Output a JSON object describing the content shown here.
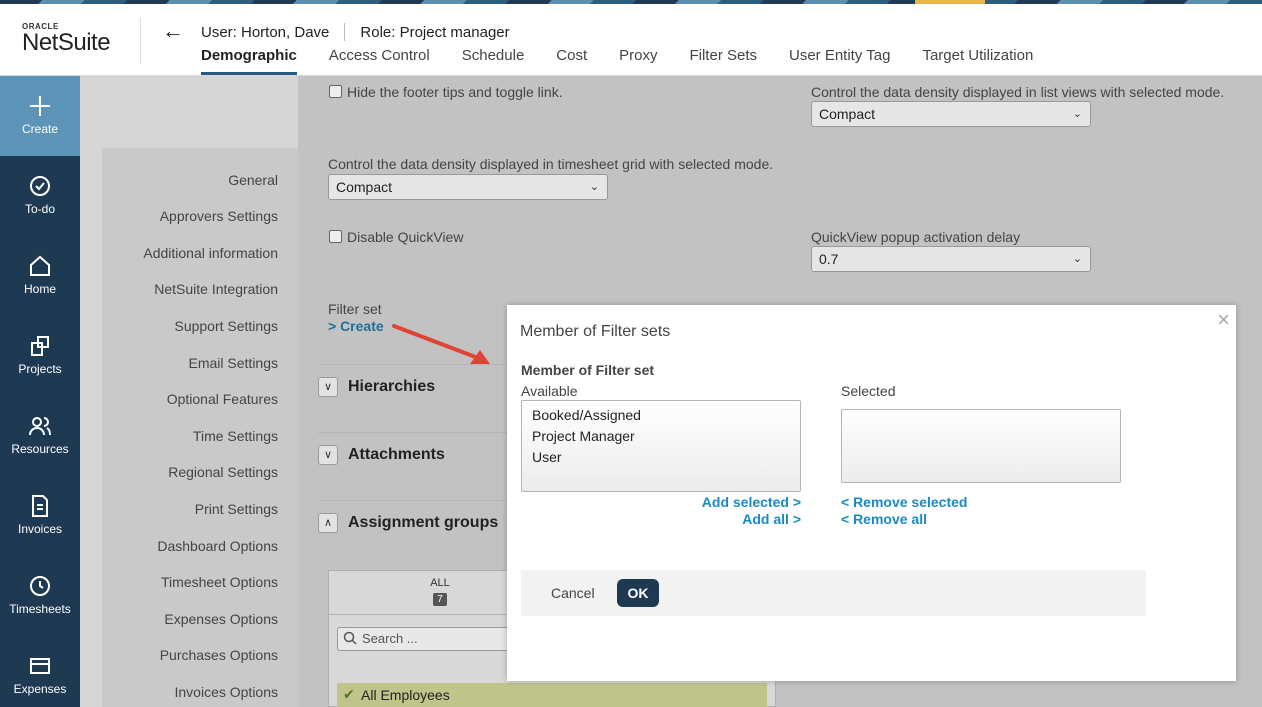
{
  "header": {
    "logo_top": "ORACLE",
    "logo_main": "NetSuite",
    "user": "User: Horton, Dave",
    "role": "Role: Project manager",
    "tabs": [
      "Demographic",
      "Access Control",
      "Schedule",
      "Cost",
      "Proxy",
      "Filter Sets",
      "User Entity Tag",
      "Target Utilization"
    ],
    "active_tab": "Demographic"
  },
  "rail": {
    "items": [
      {
        "label": "Create",
        "icon": "plus-icon"
      },
      {
        "label": "To-do",
        "icon": "check-circle-icon"
      },
      {
        "label": "Home",
        "icon": "home-icon"
      },
      {
        "label": "Projects",
        "icon": "projects-icon"
      },
      {
        "label": "Resources",
        "icon": "users-icon"
      },
      {
        "label": "Invoices",
        "icon": "document-icon"
      },
      {
        "label": "Timesheets",
        "icon": "clock-icon"
      },
      {
        "label": "Expenses",
        "icon": "card-icon"
      }
    ]
  },
  "sidenav": {
    "items": [
      "General",
      "Approvers Settings",
      "Additional information",
      "NetSuite Integration",
      "Support Settings",
      "Email Settings",
      "Optional Features",
      "Time Settings",
      "Regional Settings",
      "Print Settings",
      "Dashboard Options",
      "Timesheet Options",
      "Expenses Options",
      "Purchases Options",
      "Invoices Options"
    ]
  },
  "content": {
    "hide_footer": "Hide the footer tips and toggle link.",
    "list_density_label": "Control the data density displayed in list views with selected mode.",
    "list_density_value": "Compact",
    "timesheet_density_label": "Control the data density displayed in timesheet grid with selected mode.",
    "timesheet_density_value": "Compact",
    "disable_quickview": "Disable QuickView",
    "quickview_delay_label": "QuickView popup activation delay",
    "quickview_delay_value": "0.7",
    "filter_set_label": "Filter set",
    "filter_set_create": "> Create",
    "sections": [
      "Hierarchies",
      "Attachments",
      "Assignment groups"
    ],
    "all_label": "ALL",
    "all_count": "7",
    "search_placeholder": "Search ...",
    "all_employees": "All Employees"
  },
  "modal": {
    "title": "Member of Filter sets",
    "subtitle": "Member of Filter set",
    "available_label": "Available",
    "selected_label": "Selected",
    "available_options": [
      "Booked/Assigned",
      "Project Manager",
      "User"
    ],
    "add_selected": "Add selected >",
    "add_all": "Add all >",
    "remove_selected": "< Remove selected",
    "remove_all": "< Remove all",
    "cancel": "Cancel",
    "ok": "OK"
  }
}
